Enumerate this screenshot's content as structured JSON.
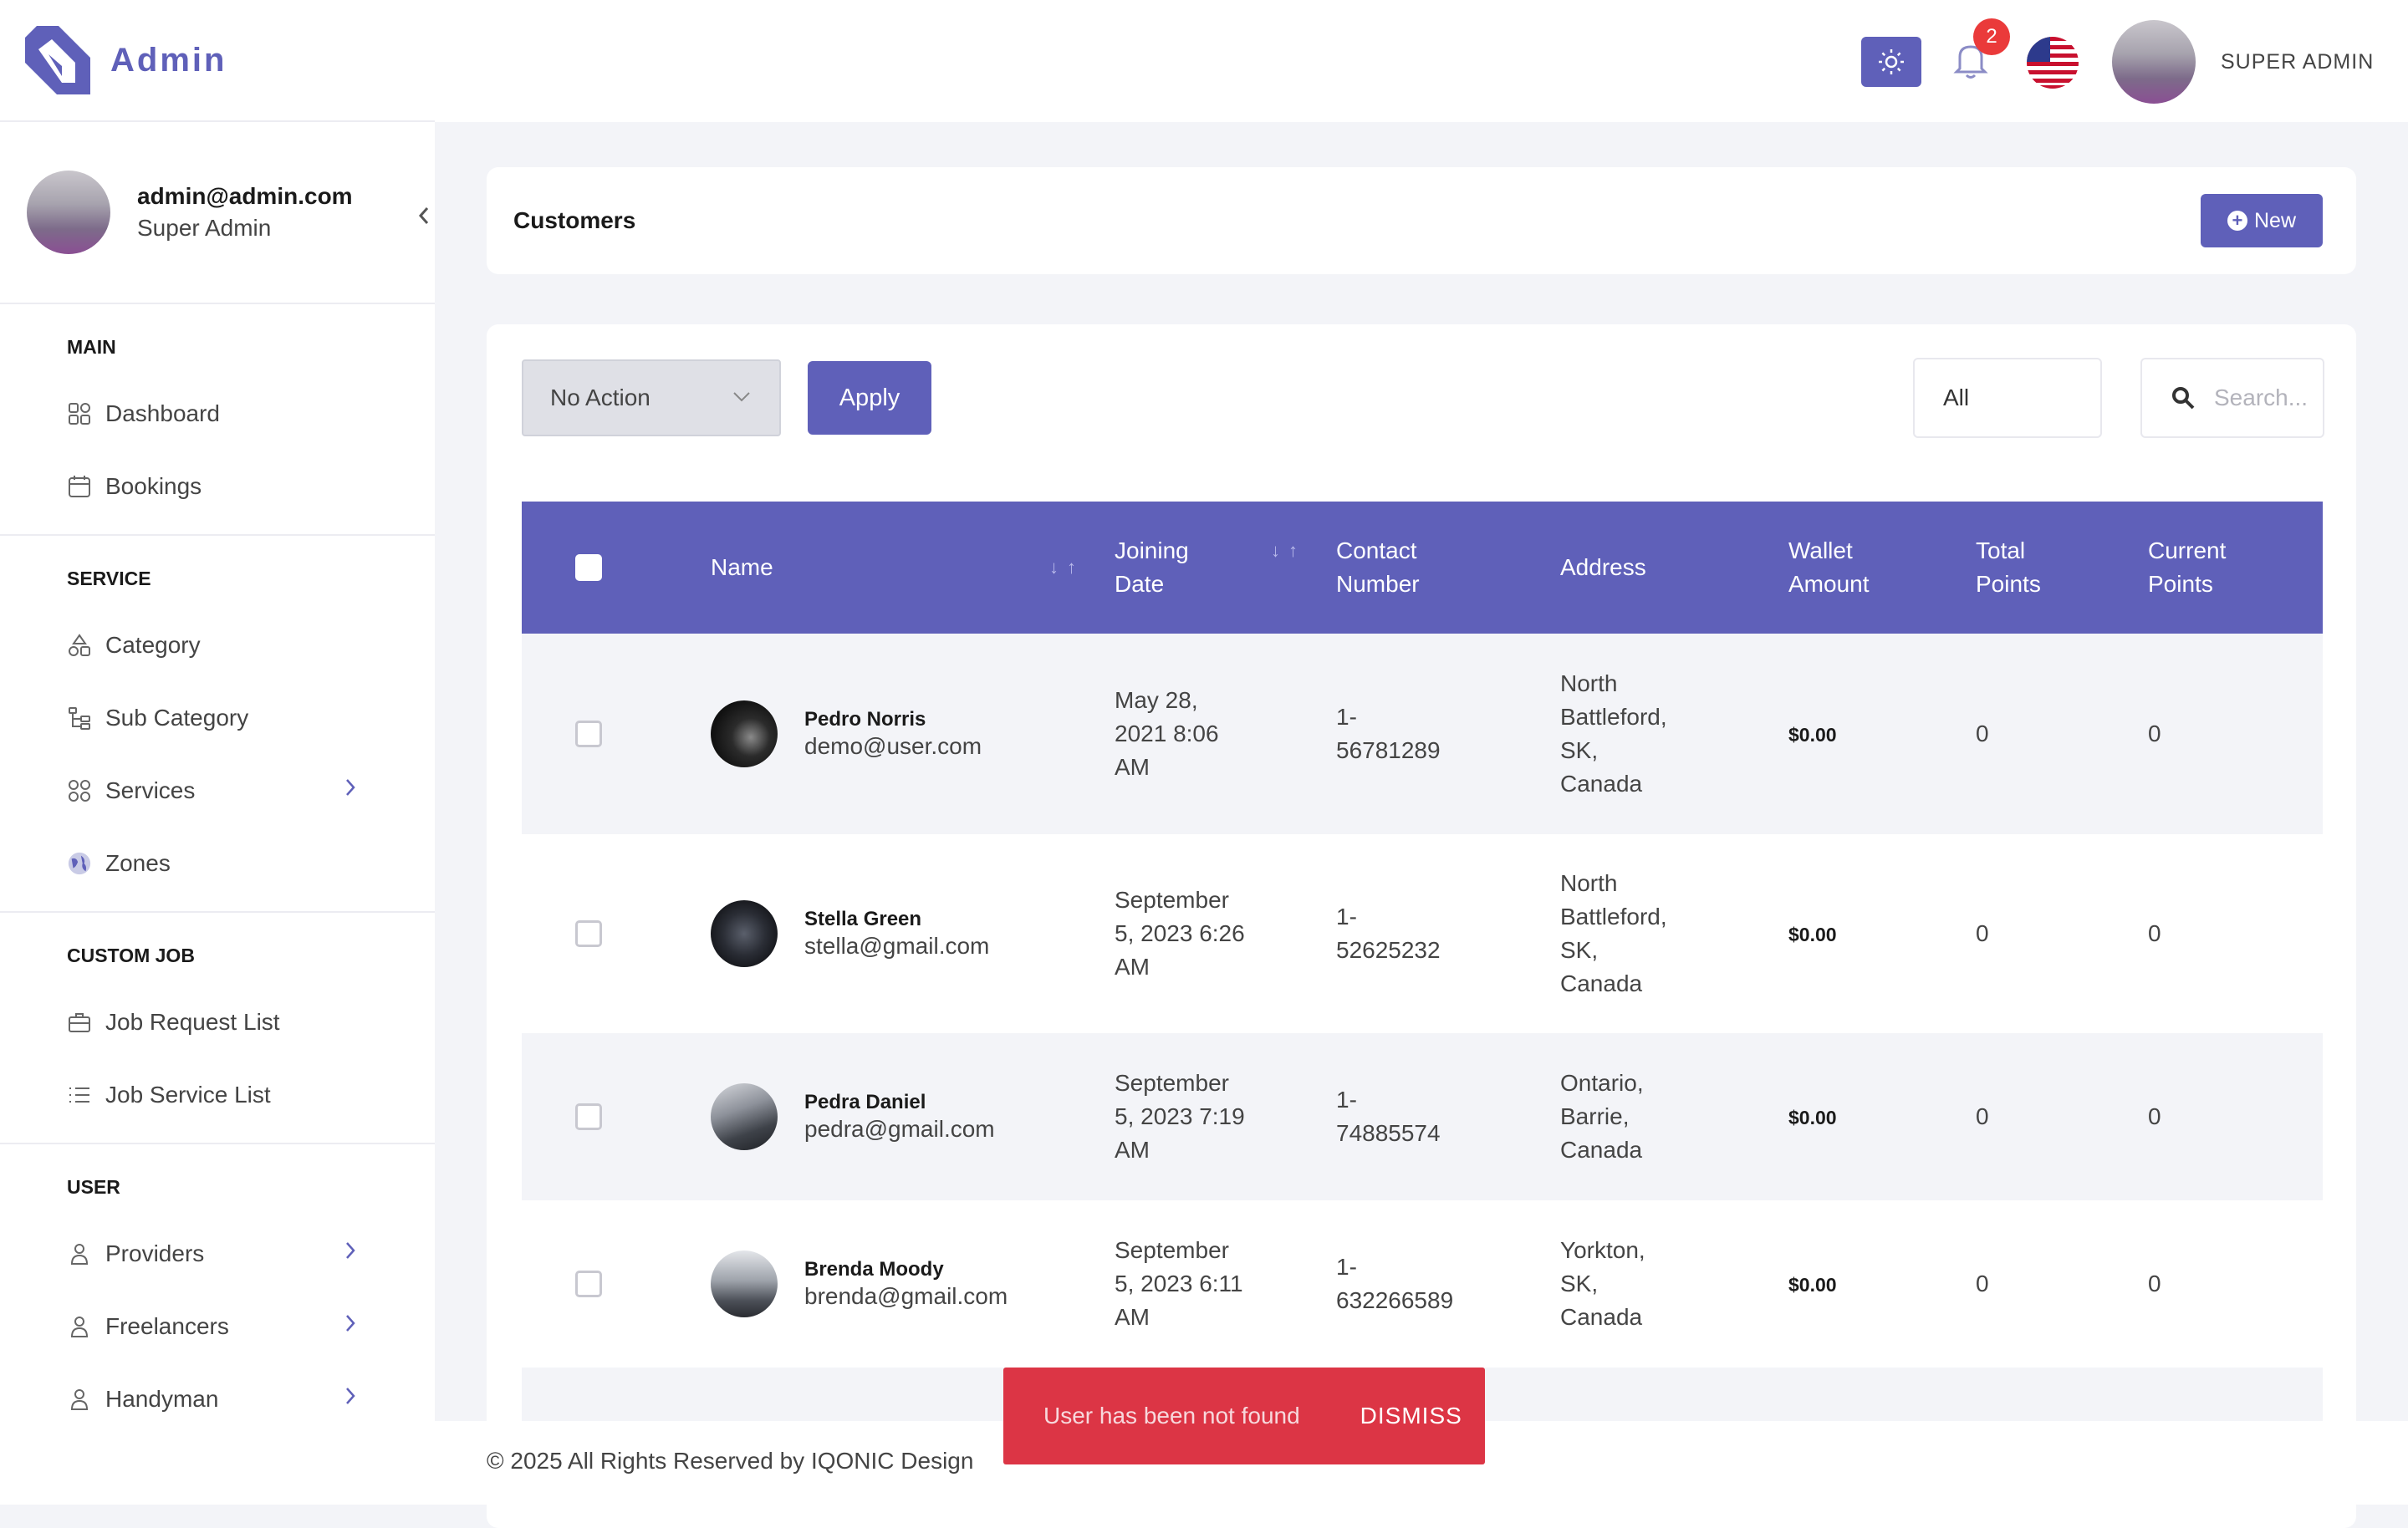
{
  "brand": {
    "name": "Admin",
    "accent": "#5f60b9"
  },
  "profile": {
    "email": "admin@admin.com",
    "role": "Super Admin"
  },
  "sidebar": {
    "sections": [
      {
        "title": "MAIN",
        "items": [
          {
            "label": "Dashboard",
            "icon": "grid-icon"
          },
          {
            "label": "Bookings",
            "icon": "calendar-icon"
          }
        ]
      },
      {
        "title": "SERVICE",
        "items": [
          {
            "label": "Category",
            "icon": "shapes-icon"
          },
          {
            "label": "Sub Category",
            "icon": "tree-icon"
          },
          {
            "label": "Services",
            "icon": "grid-icon"
          },
          {
            "label": "Zones",
            "icon": "globe-icon"
          }
        ]
      },
      {
        "title": "CUSTOM JOB",
        "items": [
          {
            "label": "Job Request List",
            "icon": "briefcase-icon"
          },
          {
            "label": "Job Service List",
            "icon": "list-icon"
          }
        ]
      },
      {
        "title": "USER",
        "items": [
          {
            "label": "Providers",
            "icon": "user-icon"
          },
          {
            "label": "Freelancers",
            "icon": "user-icon"
          },
          {
            "label": "Handyman",
            "icon": "user-icon"
          }
        ]
      }
    ]
  },
  "header": {
    "notification_count": "2",
    "user_label": "SUPER ADMIN"
  },
  "page": {
    "title": "Customers",
    "new_label": "New"
  },
  "toolbar": {
    "bulk_action": "No Action",
    "apply_label": "Apply",
    "filter_value": "All",
    "search_placeholder": "Search..."
  },
  "table": {
    "headers": {
      "name": "Name",
      "joining_date": "Joining Date",
      "contact": "Contact Number",
      "address": "Address",
      "wallet": "Wallet Amount",
      "total_points": "Total Points",
      "current_points": "Current Points"
    },
    "rows": [
      {
        "name": "Pedro Norris",
        "email": "demo@user.com",
        "joining_date": "May 28, 2021 8:06 AM",
        "contact": "1-56781289",
        "address": "North Battleford, SK, Canada",
        "wallet": "$0.00",
        "total_points": "0",
        "current_points": "0"
      },
      {
        "name": "Stella Green",
        "email": "stella@gmail.com",
        "joining_date": "September 5, 2023 6:26 AM",
        "contact": "1-52625232",
        "address": "North Battleford, SK, Canada",
        "wallet": "$0.00",
        "total_points": "0",
        "current_points": "0"
      },
      {
        "name": "Pedra Daniel",
        "email": "pedra@gmail.com",
        "joining_date": "September 5, 2023 7:19 AM",
        "contact": "1-74885574",
        "address": "Ontario, Barrie, Canada",
        "wallet": "$0.00",
        "total_points": "0",
        "current_points": "0"
      },
      {
        "name": "Brenda Moody",
        "email": "brenda@gmail.com",
        "joining_date": "September 5, 2023 6:11 AM",
        "contact": "1-632266589",
        "address": "Yorkton, SK, Canada",
        "wallet": "$0.00",
        "total_points": "0",
        "current_points": "0"
      }
    ]
  },
  "footer": {
    "text": "© 2025 All Rights Reserved by IQONIC Design"
  },
  "toast": {
    "message": "User has been not found",
    "dismiss_label": "DISMISS",
    "color": "#dc3545"
  }
}
